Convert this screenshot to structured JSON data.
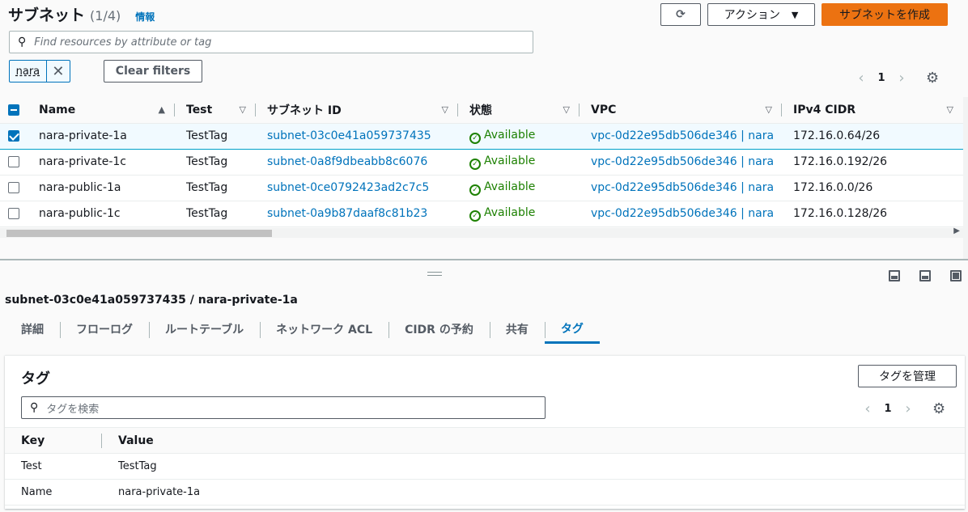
{
  "header": {
    "title": "サブネット",
    "count": "(1/4)",
    "info_link": "情報",
    "actions_label": "アクション",
    "create_label": "サブネットを作成"
  },
  "search": {
    "placeholder": "Find resources by attribute or tag"
  },
  "filter_token": {
    "value": "nara"
  },
  "clear_filters_label": "Clear filters",
  "pagination": {
    "page": "1"
  },
  "table": {
    "columns": [
      "Name",
      "Test",
      "サブネット ID",
      "状態",
      "VPC",
      "IPv4 CIDR"
    ],
    "rows": [
      {
        "selected": true,
        "name": "nara-private-1a",
        "test": "TestTag",
        "subnet_id": "subnet-03c0e41a059737435",
        "state": "Available",
        "vpc": "vpc-0d22e95db506de346 | nara",
        "cidr": "172.16.0.64/26"
      },
      {
        "selected": false,
        "name": "nara-private-1c",
        "test": "TestTag",
        "subnet_id": "subnet-0a8f9dbeabb8c6076",
        "state": "Available",
        "vpc": "vpc-0d22e95db506de346 | nara",
        "cidr": "172.16.0.192/26"
      },
      {
        "selected": false,
        "name": "nara-public-1a",
        "test": "TestTag",
        "subnet_id": "subnet-0ce0792423ad2c7c5",
        "state": "Available",
        "vpc": "vpc-0d22e95db506de346 | nara",
        "cidr": "172.16.0.0/26"
      },
      {
        "selected": false,
        "name": "nara-public-1c",
        "test": "TestTag",
        "subnet_id": "subnet-0a9b87daaf8c81b23",
        "state": "Available",
        "vpc": "vpc-0d22e95db506de346 | nara",
        "cidr": "172.16.0.128/26"
      }
    ]
  },
  "split_panel": {
    "title": "subnet-03c0e41a059737435 / nara-private-1a",
    "tabs": [
      "詳細",
      "フローログ",
      "ルートテーブル",
      "ネットワーク ACL",
      "CIDR の予約",
      "共有",
      "タグ"
    ],
    "active_tab": "タグ",
    "tags_card": {
      "title": "タグ",
      "manage_label": "タグを管理",
      "search_placeholder": "タグを検索",
      "page": "1",
      "columns": [
        "Key",
        "Value"
      ],
      "rows": [
        {
          "key": "Test",
          "value": "TestTag"
        },
        {
          "key": "Name",
          "value": "nara-private-1a"
        }
      ]
    }
  },
  "colors": {
    "primary": "#ec7211",
    "link": "#0073bb",
    "success": "#1d8102"
  }
}
